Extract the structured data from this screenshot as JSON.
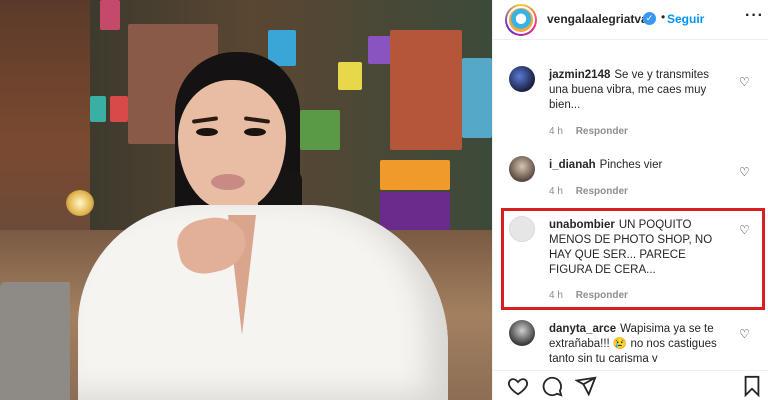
{
  "post": {
    "username": "vengalaalegriatva",
    "separator": "•",
    "follow_label": "Seguir",
    "more_label": "···"
  },
  "comments": [
    {
      "user": "jazmin2148",
      "text": "Se ve y transmites una buena vibra, me caes muy bien...",
      "time": "4 h",
      "reply": "Responder"
    },
    {
      "user": "i_dianah",
      "text": "Pinches vier",
      "time": "4 h",
      "reply": "Responder"
    },
    {
      "user": "unabombier",
      "text": "UN POQUITO MENOS DE PHOTO SHOP, NO HAY QUE SER... PARECE FIGURA DE CERA...",
      "time": "4 h",
      "reply": "Responder"
    },
    {
      "user": "danyta_arce",
      "text": "Wapisima ya se te extrañaba!!! 😢 no nos castigues tanto sin tu carisma y",
      "time": "",
      "reply": ""
    }
  ],
  "icons": {
    "verified": "verified-icon",
    "like": "heart-icon",
    "comment": "comment-icon",
    "share": "share-icon",
    "save": "bookmark-icon"
  },
  "colors": {
    "accent": "#0095f6",
    "highlight_border": "#d81f1f",
    "verified": "#3897f0"
  }
}
